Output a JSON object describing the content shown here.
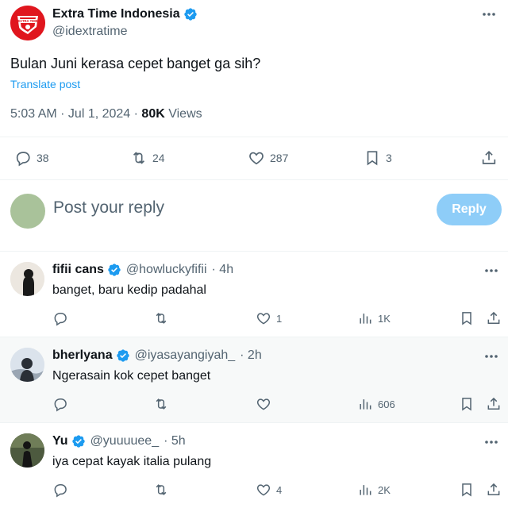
{
  "post": {
    "author": {
      "name": "Extra Time Indonesia",
      "handle": "@idextratime",
      "verified": true,
      "avatar_logo_text": "EXTRA TIME"
    },
    "text": "Bulan Juni kerasa cepet banget ga sih?",
    "translate_label": "Translate post",
    "time": "5:03 AM · Jul 1, 2024 · ",
    "views_count": "80K",
    "views_label": " Views",
    "stats": {
      "replies": "38",
      "reposts": "24",
      "likes": "287",
      "bookmarks": "3"
    }
  },
  "composer": {
    "placeholder": "Post your reply",
    "button_label": "Reply"
  },
  "replies": [
    {
      "name": "fifii cans",
      "handle": "@howluckyfifii",
      "time": "· 4h",
      "text": "banget, baru kedip padahal",
      "likes": "1",
      "views": "1K"
    },
    {
      "name": "bherlyana",
      "handle": "@iyasayangiyah_",
      "time": "· 2h",
      "text": "Ngerasain kok cepet banget",
      "likes": "",
      "views": "606"
    },
    {
      "name": "Yu",
      "handle": "@yuuuuee_",
      "time": "· 5h",
      "text": "iya cepat kayak italia pulang",
      "likes": "4",
      "views": "2K"
    }
  ],
  "colors": {
    "accent": "#1d9bf0",
    "reply_button": "#8ecdf8",
    "secondary_text": "#536471",
    "highlight_row": "#f7f9f9"
  }
}
